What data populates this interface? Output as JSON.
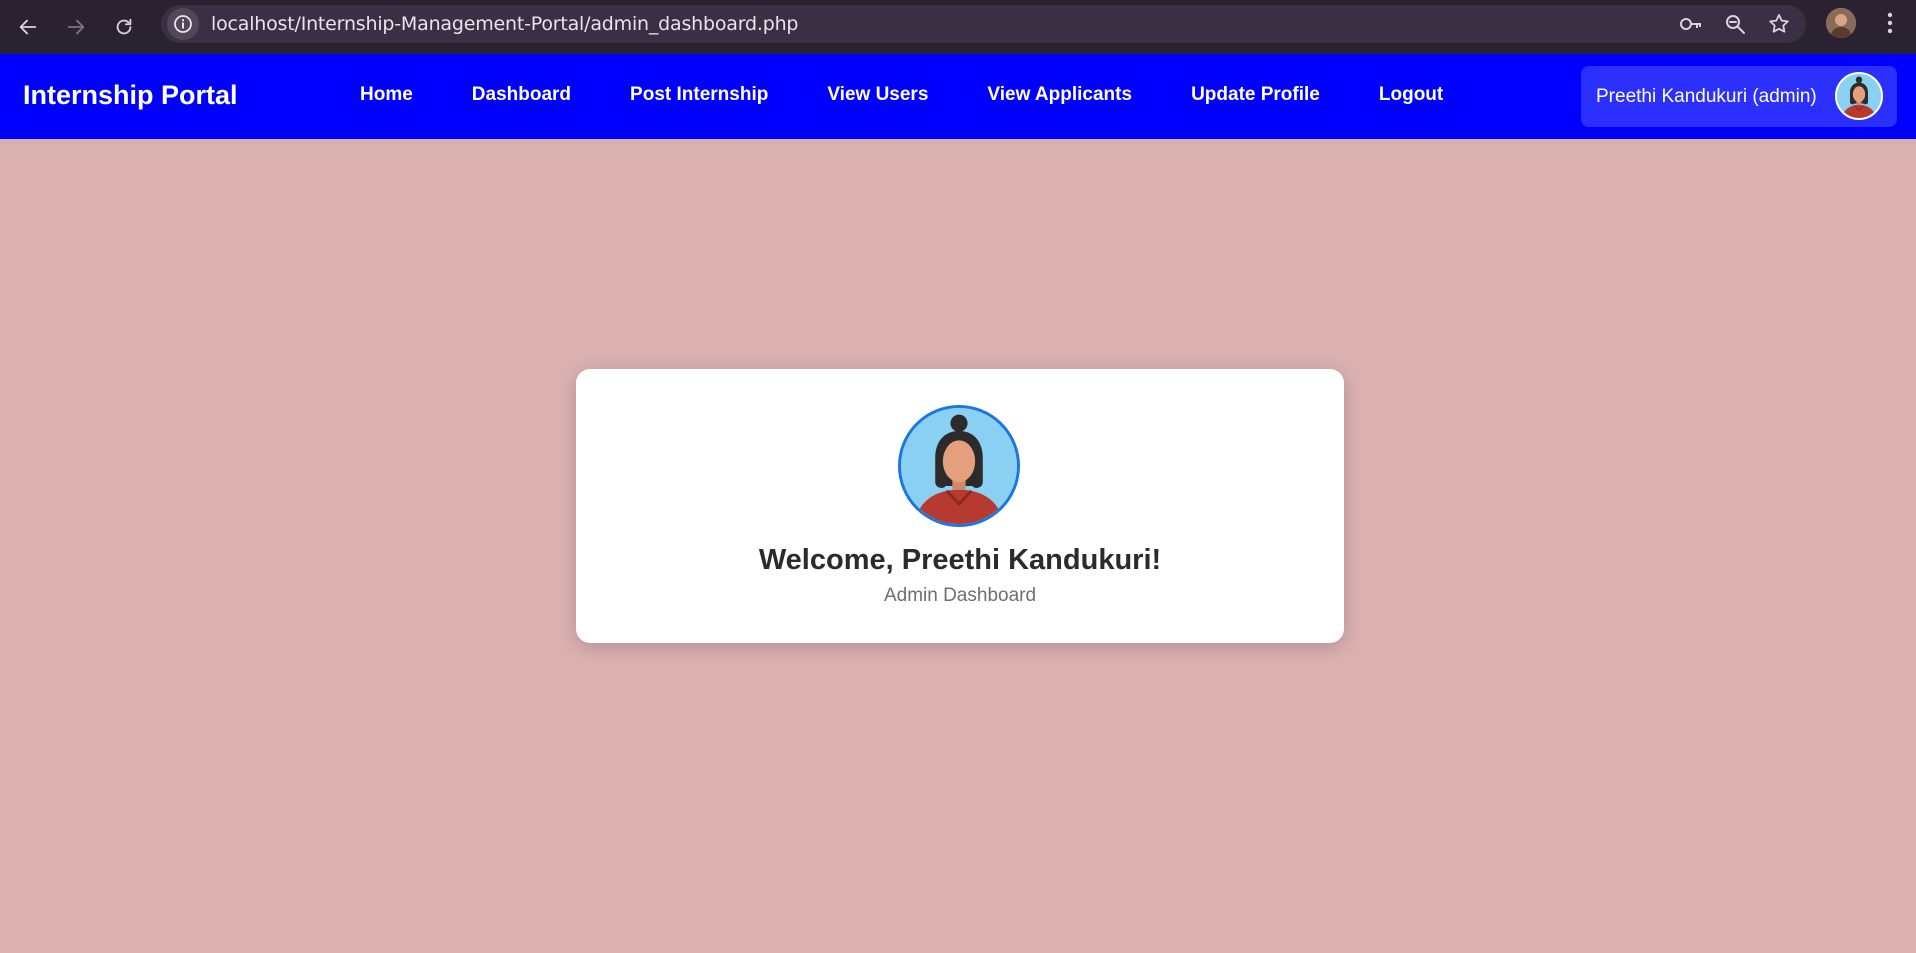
{
  "browser": {
    "url": "localhost/Internship-Management-Portal/admin_dashboard.php",
    "icons": [
      "back-arrow-icon",
      "forward-arrow-icon",
      "reload-icon",
      "site-info-icon",
      "password-key-icon",
      "zoom-icon",
      "bookmark-star-icon",
      "kebab-menu-icon"
    ]
  },
  "navbar": {
    "brand": "Internship Portal",
    "links": [
      {
        "label": "Home"
      },
      {
        "label": "Dashboard"
      },
      {
        "label": "Post Internship"
      },
      {
        "label": "View Users"
      },
      {
        "label": "View Applicants"
      },
      {
        "label": "Update Profile"
      },
      {
        "label": "Logout"
      }
    ],
    "user_label": "Preethi Kandukuri (admin)"
  },
  "card": {
    "welcome": "Welcome, Preethi Kandukuri!",
    "subtitle": "Admin Dashboard"
  },
  "colors": {
    "page_background": "#dbb0b1",
    "navbar": "#0000fe",
    "user_chip": "#2b30ff",
    "avatar_ring": "#1b76e2",
    "chrome": "#2a2131"
  }
}
